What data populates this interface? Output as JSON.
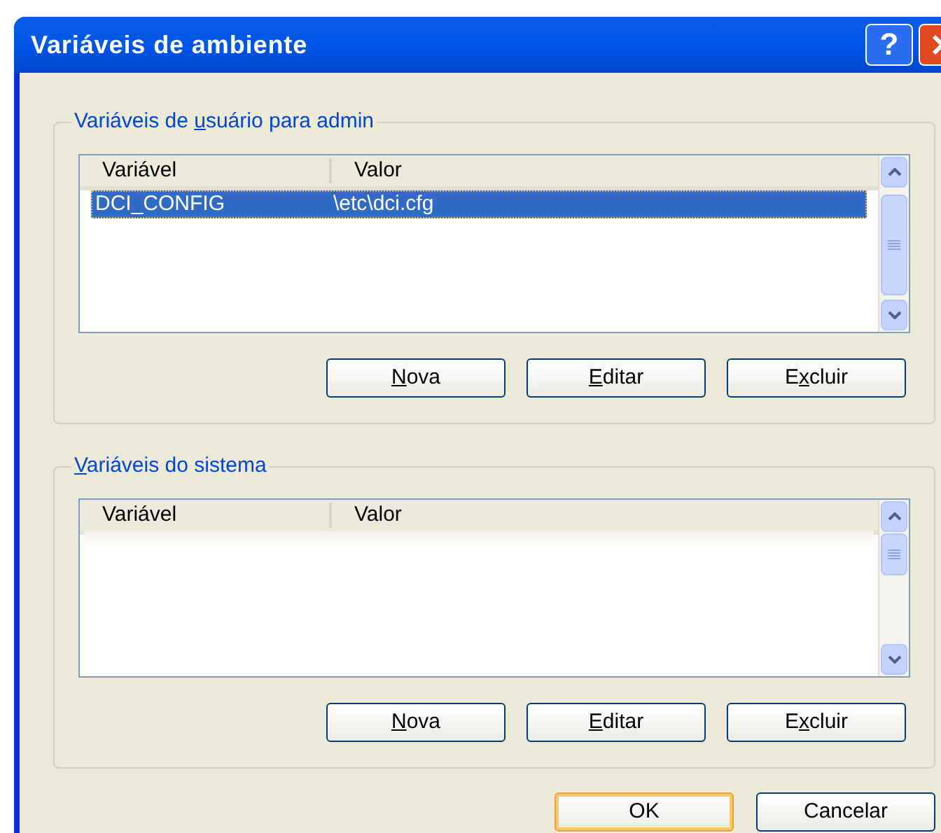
{
  "window": {
    "title": "Variáveis de ambiente",
    "controls": [
      {
        "kind": "help",
        "label": "?"
      },
      {
        "kind": "close"
      }
    ]
  },
  "groups": [
    {
      "legend": [
        {
          "text": "Variáveis de ",
          "underlined": false
        },
        {
          "text": "u",
          "underlined": true
        },
        {
          "text": "suário para admin",
          "underlined": false
        }
      ],
      "columns": [
        "Variável",
        "Valor"
      ],
      "rows": [
        {
          "kind": "data",
          "cells": [
            "DCI_CONFIG",
            "\\etc\\dci.cfg"
          ],
          "selected": true
        }
      ],
      "buttons": [
        {
          "label": [
            {
              "text": "N",
              "underlined": true
            },
            {
              "text": "ova",
              "underlined": false
            }
          ]
        },
        {
          "label": [
            {
              "text": "E",
              "underlined": true
            },
            {
              "text": "ditar",
              "underlined": false
            }
          ]
        },
        {
          "label": [
            {
              "text": "E",
              "underlined": false
            },
            {
              "text": "x",
              "underlined": true
            },
            {
              "text": "cluir",
              "underlined": false
            }
          ]
        }
      ]
    },
    {
      "legend": [
        {
          "text": "V",
          "underlined": true
        },
        {
          "text": "ariáveis do sistema",
          "underlined": false
        }
      ],
      "columns": [
        "Variável",
        "Valor"
      ],
      "rows": [
        {
          "kind": "redacted"
        }
      ],
      "buttons": [
        {
          "label": [
            {
              "text": "N",
              "underlined": true
            },
            {
              "text": "ova",
              "underlined": false
            }
          ]
        },
        {
          "label": [
            {
              "text": "E",
              "underlined": true
            },
            {
              "text": "ditar",
              "underlined": false
            }
          ]
        },
        {
          "label": [
            {
              "text": "E",
              "underlined": false
            },
            {
              "text": "x",
              "underlined": true
            },
            {
              "text": "cluir",
              "underlined": false
            }
          ]
        }
      ]
    }
  ],
  "buttons": [
    {
      "label": "OK",
      "default": true
    },
    {
      "label": "Cancelar",
      "default": false
    }
  ]
}
